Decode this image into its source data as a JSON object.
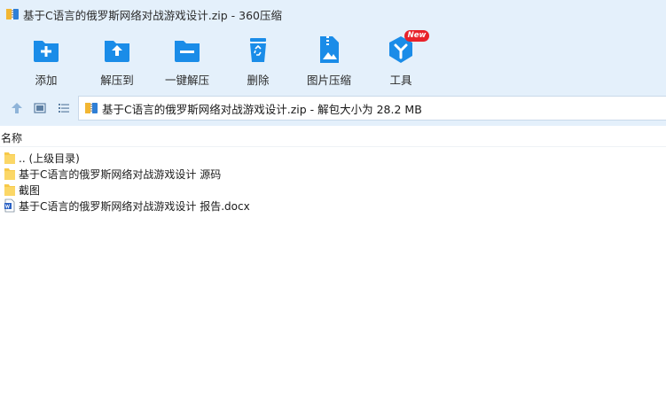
{
  "window": {
    "title": "基于C语言的俄罗斯网络对战游戏设计.zip - 360压缩"
  },
  "toolbar": {
    "items": [
      {
        "label": "添加",
        "icon": "add-file-icon"
      },
      {
        "label": "解压到",
        "icon": "extract-to-icon"
      },
      {
        "label": "一键解压",
        "icon": "one-click-extract-icon"
      },
      {
        "label": "删除",
        "icon": "recycle-bin-icon"
      },
      {
        "label": "图片压缩",
        "icon": "image-compress-icon"
      },
      {
        "label": "工具",
        "icon": "tools-cube-icon",
        "badge": "New"
      }
    ]
  },
  "nav": {
    "up_icon": "arrow-up-icon",
    "thumbnail_icon": "thumbnail-view-icon",
    "list_icon": "list-view-icon"
  },
  "address": {
    "text": "基于C语言的俄罗斯网络对战游戏设计.zip - 解包大小为 28.2 MB"
  },
  "list": {
    "column_name": "名称",
    "rows": [
      {
        "name": ".. (上级目录)",
        "type": "folder"
      },
      {
        "name": "基于C语言的俄罗斯网络对战游戏设计 源码",
        "type": "folder"
      },
      {
        "name": "截图",
        "type": "folder"
      },
      {
        "name": "基于C语言的俄罗斯网络对战游戏设计 报告.docx",
        "type": "docx"
      }
    ]
  },
  "colors": {
    "chrome_bg": "#e4f0fb",
    "icon_blue": "#1a8ce8",
    "folder_yellow": "#f7c948",
    "badge_red": "#e8222b"
  }
}
